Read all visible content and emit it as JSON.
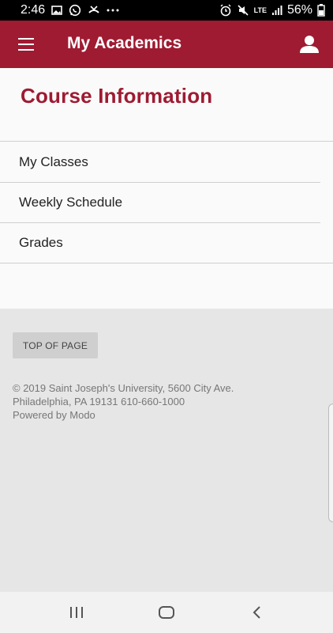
{
  "status_bar": {
    "time": "2:46",
    "battery": "56%",
    "network": "LTE",
    "left_icons": [
      "image-icon",
      "whatsapp-icon",
      "missed-call-icon",
      "more-dots-icon"
    ],
    "right_icons": [
      "alarm-icon",
      "mute-icon",
      "lte-icon",
      "signal-icon",
      "battery-icon"
    ]
  },
  "header": {
    "title": "My Academics",
    "background": "#9e1b32"
  },
  "main": {
    "section_title": "Course Information",
    "items": [
      {
        "label": "My Classes"
      },
      {
        "label": "Weekly Schedule"
      },
      {
        "label": "Grades"
      }
    ]
  },
  "footer": {
    "top_button": "TOP OF PAGE",
    "copyright_lines": [
      "© 2019 Saint Joseph's University, 5600 City Ave.",
      "Philadelphia, PA 19131 610-660-1000",
      "Powered by Modo"
    ]
  },
  "colors": {
    "accent": "#9e1b32",
    "content_bg": "#fafafa",
    "footer_bg": "#e6e6e6"
  }
}
